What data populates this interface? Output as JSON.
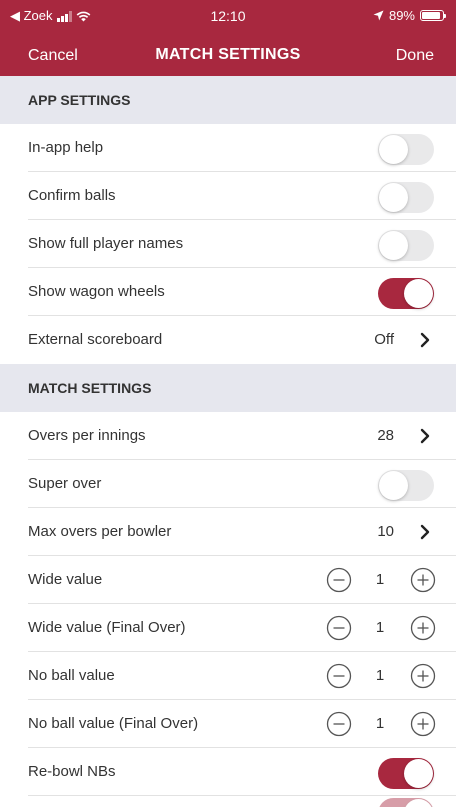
{
  "status_bar": {
    "back_app": "◀ Zoek",
    "time": "12:10",
    "battery": "89%"
  },
  "nav": {
    "cancel_label": "Cancel",
    "title": "MATCH SETTINGS",
    "done_label": "Done"
  },
  "sections": {
    "app_settings": "APP SETTINGS",
    "match_settings": "MATCH SETTINGS"
  },
  "rows": {
    "in_app_help": {
      "label": "In-app help",
      "toggle": false
    },
    "confirm_balls": {
      "label": "Confirm balls",
      "toggle": false
    },
    "show_full_player_names": {
      "label": "Show full player names",
      "toggle": false
    },
    "show_wagon_wheels": {
      "label": "Show wagon wheels",
      "toggle": true
    },
    "external_scoreboard": {
      "label": "External scoreboard",
      "value": "Off"
    },
    "overs_per_innings": {
      "label": "Overs per innings",
      "value": "28"
    },
    "super_over": {
      "label": "Super over",
      "toggle": false
    },
    "max_overs_per_bowler": {
      "label": "Max overs per bowler",
      "value": "10"
    },
    "wide_value": {
      "label": "Wide value",
      "value": "1"
    },
    "wide_value_final_over": {
      "label": "Wide value (Final Over)",
      "value": "1"
    },
    "no_ball_value": {
      "label": "No ball value",
      "value": "1"
    },
    "no_ball_value_final_over": {
      "label": "No ball value (Final Over)",
      "value": "1"
    },
    "rebowl_nbs": {
      "label": "Re-bowl NBs",
      "toggle": true
    }
  },
  "colors": {
    "accent": "#a8283f",
    "section_bg": "#e6e7ee",
    "toggle_off": "#e9e9ea"
  },
  "icons": {
    "chevron": "chevron-right-icon",
    "minus": "minus-circle-icon",
    "plus": "plus-circle-icon"
  }
}
